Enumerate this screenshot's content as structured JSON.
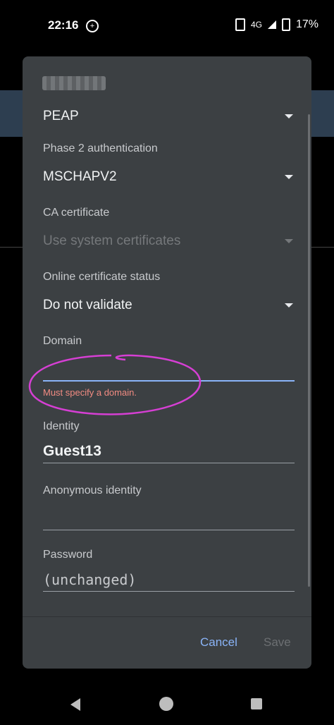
{
  "status_bar": {
    "time": "22:16",
    "network": "4G",
    "battery": "17%"
  },
  "dialog": {
    "eap_method": "PEAP",
    "phase2": {
      "label": "Phase 2 authentication",
      "value": "MSCHAPV2"
    },
    "ca_cert": {
      "label": "CA certificate",
      "value": "Use system certificates"
    },
    "cert_status": {
      "label": "Online certificate status",
      "value": "Do not validate"
    },
    "domain": {
      "label": "Domain",
      "value": "",
      "error": "Must specify a domain."
    },
    "identity": {
      "label": "Identity",
      "value": "Guest13"
    },
    "anon_identity": {
      "label": "Anonymous identity",
      "value": ""
    },
    "password": {
      "label": "Password",
      "placeholder": "(unchanged)"
    },
    "buttons": {
      "cancel": "Cancel",
      "save": "Save"
    }
  },
  "colors": {
    "dialog_bg": "#3c4043",
    "accent": "#8ab4f8",
    "error": "#f28b82",
    "annotation": "#d63fd4"
  },
  "icons": [
    "vibrate-icon",
    "signal-icon",
    "battery-icon",
    "back-icon",
    "home-icon",
    "recents-icon"
  ]
}
